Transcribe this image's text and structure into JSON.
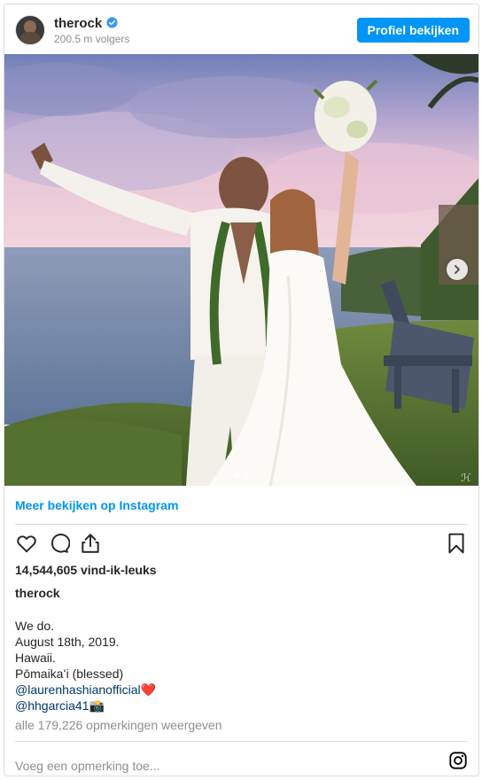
{
  "header": {
    "username": "therock",
    "followers": "200.5 m volgers",
    "profile_button": "Profiel bekijken"
  },
  "post": {
    "more_link": "Meer bekijken op Instagram",
    "likes": "14,544,605 vind-ik-leuks",
    "caption_user": "therock",
    "caption_lines": [
      "We do.",
      "August 18th, 2019.",
      "Hawaii.",
      "Pōmaikaʻi (blessed)"
    ],
    "mention_1": "@laurenhashianofficial",
    "mention_1_emoji": "❤️",
    "mention_2": "@hhgarcia41",
    "mention_2_emoji": "📸",
    "comments_link": "alle 179,226 opmerkingen weergeven",
    "comment_placeholder": "Voeg een opmerking toe..."
  },
  "carousel": {
    "slide": 1,
    "total": 2
  },
  "colors": {
    "accent": "#0095f6",
    "mention": "#00376b",
    "muted": "#8e8e8e"
  },
  "icons": [
    "verified-badge-icon",
    "heart-icon",
    "comment-icon",
    "share-icon",
    "bookmark-icon",
    "chevron-right-icon",
    "instagram-icon"
  ]
}
